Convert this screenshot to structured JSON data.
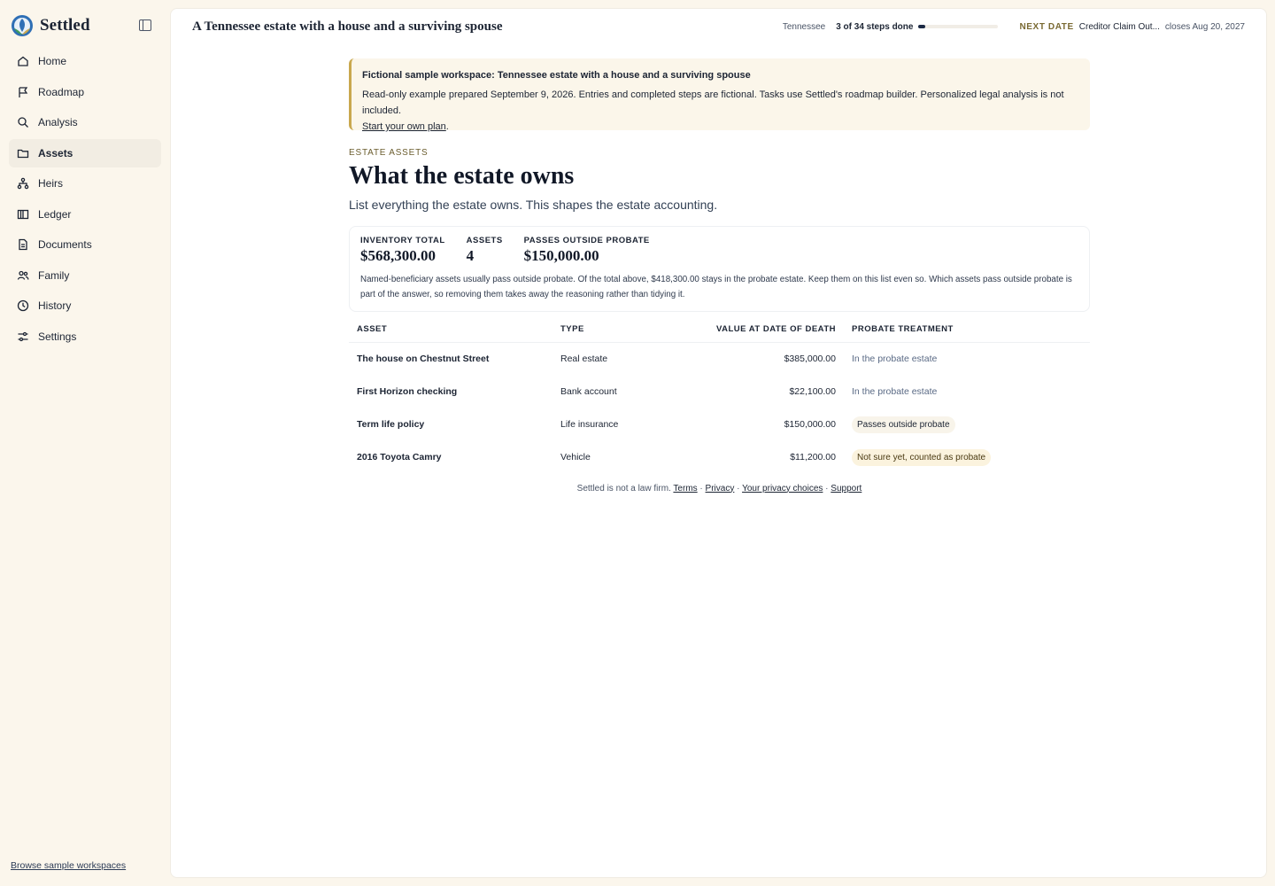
{
  "app": {
    "name": "Settled"
  },
  "sidebar": {
    "items": [
      {
        "label": "Home",
        "icon": "home-icon"
      },
      {
        "label": "Roadmap",
        "icon": "flag-icon"
      },
      {
        "label": "Analysis",
        "icon": "search-icon"
      },
      {
        "label": "Assets",
        "icon": "folder-icon",
        "active": true
      },
      {
        "label": "Heirs",
        "icon": "hierarchy-icon"
      },
      {
        "label": "Ledger",
        "icon": "book-icon"
      },
      {
        "label": "Documents",
        "icon": "document-icon"
      },
      {
        "label": "Family",
        "icon": "people-icon"
      },
      {
        "label": "History",
        "icon": "clock-icon"
      },
      {
        "label": "Settings",
        "icon": "sliders-icon"
      }
    ],
    "browse_link": "Browse sample workspaces"
  },
  "topbar": {
    "title": "A Tennessee estate with a house and a surviving spouse",
    "state": "Tennessee",
    "steps": "3 of 34 steps done",
    "progress_fraction": 0.0882,
    "next_label": "NEXT DATE",
    "next_name": "Creditor Claim Out...",
    "next_close": "closes Aug 20, 2027"
  },
  "banner": {
    "title": "Fictional sample workspace: Tennessee estate with a house and a surviving spouse",
    "body": "Read-only example prepared September 9, 2026. Entries and completed steps are fictional. Tasks use Settled's roadmap builder. Personalized legal analysis is not included.",
    "link": "Start your own plan",
    "link_suffix": "."
  },
  "page": {
    "eyebrow": "ESTATE ASSETS",
    "title": "What the estate owns",
    "subtitle": "List everything the estate owns. This shapes the estate accounting."
  },
  "stats": {
    "inventory_label": "INVENTORY TOTAL",
    "inventory_value": "$568,300.00",
    "assets_label": "ASSETS",
    "assets_value": "4",
    "outside_label": "PASSES OUTSIDE PROBATE",
    "outside_value": "$150,000.00",
    "note": "Named-beneficiary assets usually pass outside probate. Of the total above, $418,300.00 stays in the probate estate. Keep them on this list even so. Which assets pass outside probate is part of the answer, so removing them takes away the reasoning rather than tidying it."
  },
  "table": {
    "headers": {
      "asset": "ASSET",
      "type": "TYPE",
      "value": "VALUE AT DATE OF DEATH",
      "treatment": "PROBATE TREATMENT"
    },
    "rows": [
      {
        "asset": "The house on Chestnut Street",
        "type": "Real estate",
        "value": "$385,000.00",
        "treatment": "In the probate estate"
      },
      {
        "asset": "First Horizon checking",
        "type": "Bank account",
        "value": "$22,100.00",
        "treatment": "In the probate estate"
      },
      {
        "asset": "Term life policy",
        "type": "Life insurance",
        "value": "$150,000.00",
        "treatment": "Passes outside probate"
      },
      {
        "asset": "2016 Toyota Camry",
        "type": "Vehicle",
        "value": "$11,200.00",
        "treatment": "Not sure yet, counted as probate"
      }
    ]
  },
  "footer": {
    "text": "Settled is not a law firm.",
    "links": [
      "Terms",
      "Privacy",
      "Your privacy choices",
      "Support"
    ]
  },
  "colors": {
    "accent_gold": "#c9a84e",
    "navy": "#1c2a45",
    "background": "#fbf6ec"
  }
}
